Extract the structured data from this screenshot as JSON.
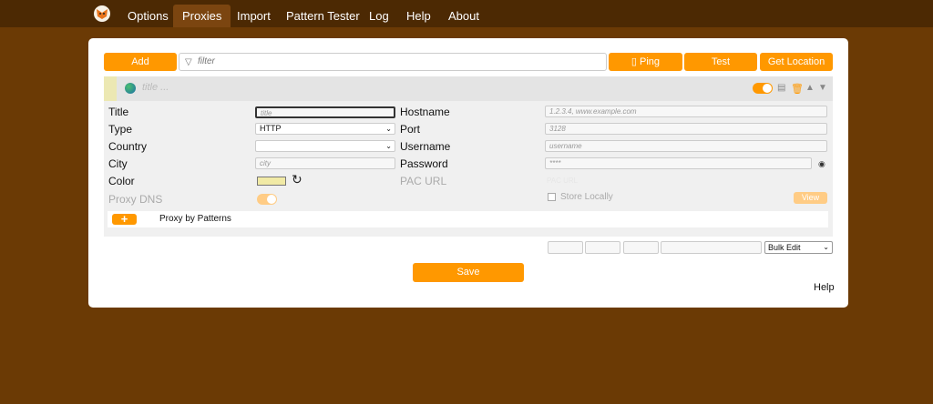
{
  "nav": {
    "items": [
      {
        "label": "Options"
      },
      {
        "label": "Proxies"
      },
      {
        "label": "Import"
      },
      {
        "label": "Pattern Tester"
      },
      {
        "label": "Log"
      },
      {
        "label": "Help"
      },
      {
        "label": "About"
      }
    ]
  },
  "toolbar": {
    "add_label": "Add",
    "filter_placeholder": "filter",
    "ping_label": "Ping",
    "test_label": "Test",
    "get_location_label": "Get Location"
  },
  "proxy": {
    "title_placeholder": "title ...",
    "fields": {
      "title_label": "Title",
      "title_placeholder": "title",
      "type_label": "Type",
      "type_value": "HTTP",
      "country_label": "Country",
      "country_value": "",
      "city_label": "City",
      "city_placeholder": "city",
      "color_label": "Color",
      "proxy_dns_label": "Proxy DNS",
      "hostname_label": "Hostname",
      "hostname_placeholder": "1.2.3.4, www.example.com",
      "port_label": "Port",
      "port_placeholder": "3128",
      "username_label": "Username",
      "username_placeholder": "username",
      "password_label": "Password",
      "password_placeholder": "****",
      "pac_url_label": "PAC URL",
      "pac_url_placeholder": "PAC URL",
      "store_locally_label": "Store Locally",
      "view_label": "View"
    },
    "patterns_label": "Proxy by Patterns",
    "add_pattern_label": "+"
  },
  "bulk_edit": {
    "selected": "Bulk Edit"
  },
  "save_label": "Save",
  "help_label": "Help",
  "colors": {
    "accent": "#ff9800",
    "background": "#6b3a05",
    "topbar": "#4c2903",
    "proxy_color": "#f1eaa5"
  }
}
